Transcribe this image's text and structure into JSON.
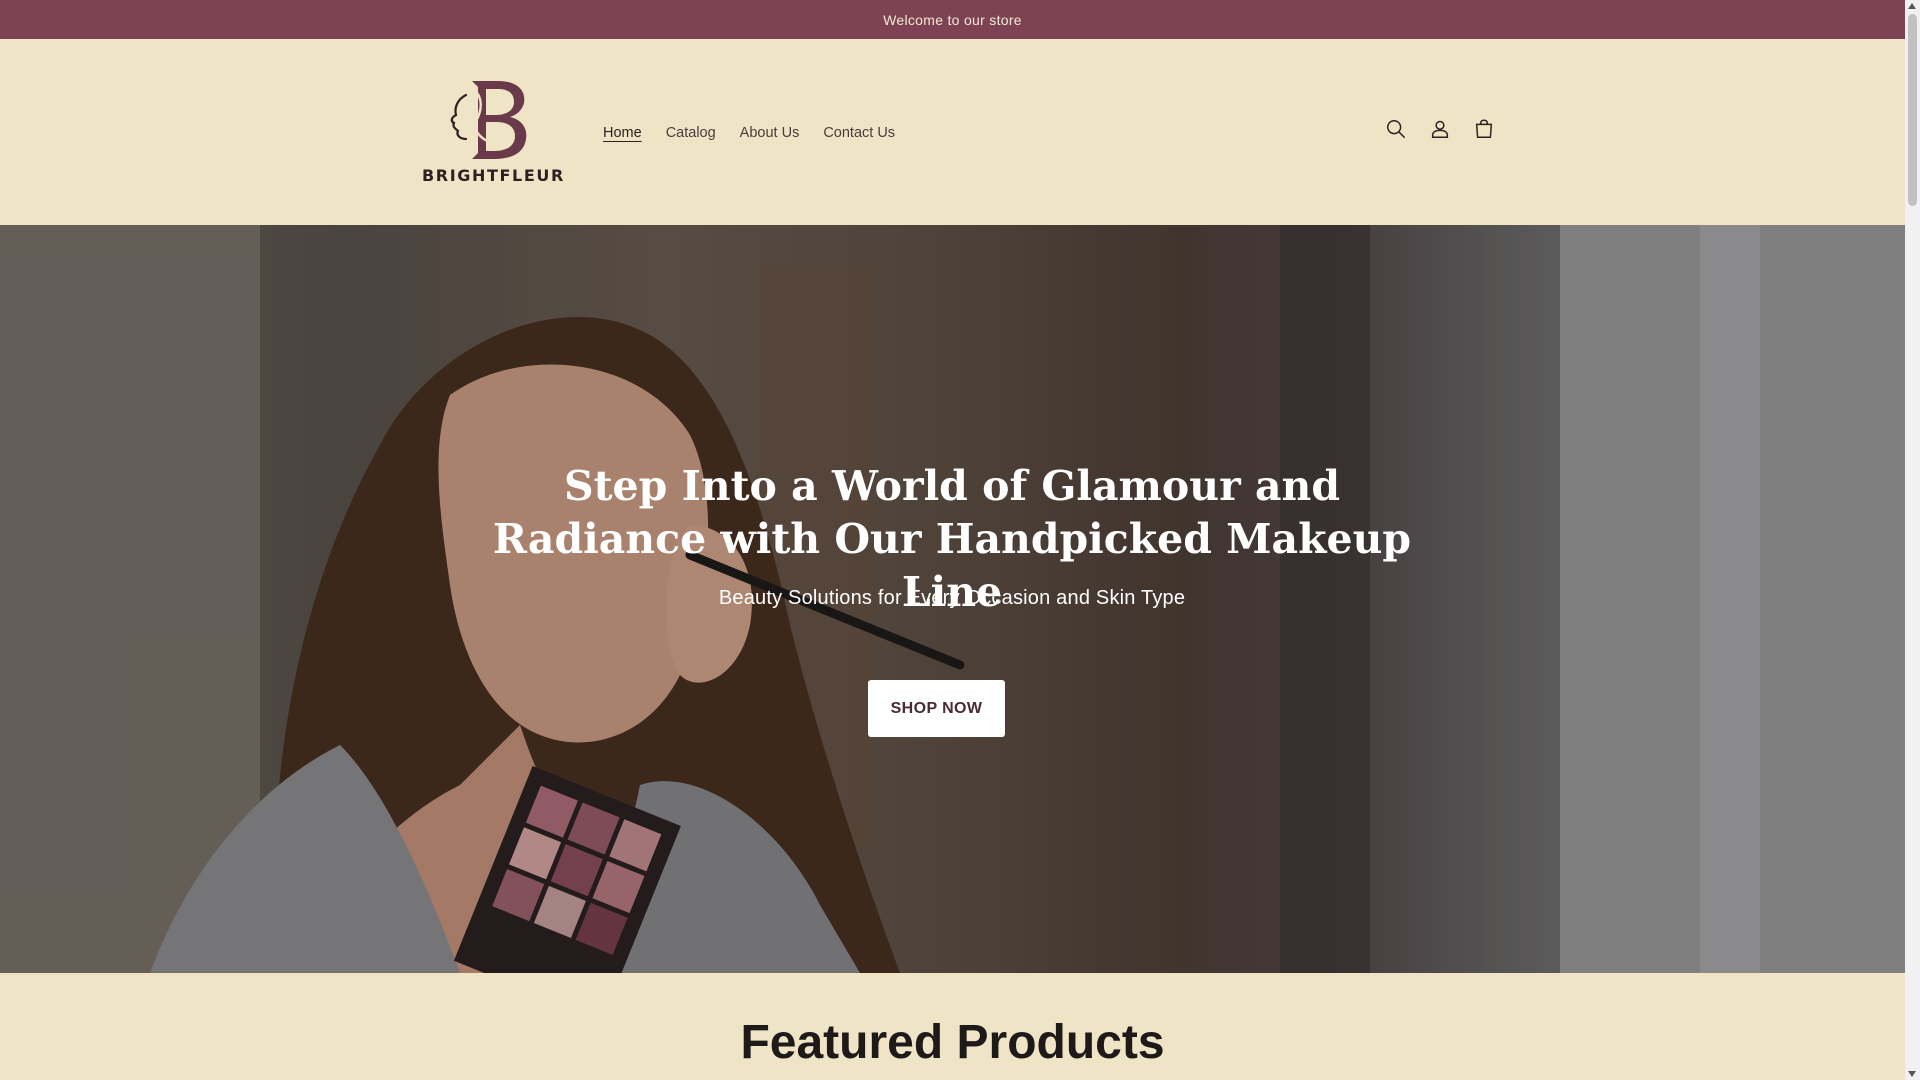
{
  "announcement": {
    "text": "Welcome to our store"
  },
  "brand": {
    "name": "BRIGHTFLEUR",
    "logo_color": "#6b3a4a"
  },
  "nav": {
    "items": [
      {
        "label": "Home",
        "active": true
      },
      {
        "label": "Catalog",
        "active": false
      },
      {
        "label": "About Us",
        "active": false
      },
      {
        "label": "Contact Us",
        "active": false
      }
    ]
  },
  "header_icons": [
    "search-icon",
    "account-icon",
    "cart-icon"
  ],
  "hero": {
    "title": "Step Into a World of Glamour and Radiance with Our Handpicked Makeup Line",
    "subtitle": "Beauty Solutions for Every Occasion and Skin Type",
    "button_label": "SHOP NOW"
  },
  "featured": {
    "title": "Featured Products"
  },
  "colors": {
    "announcement_bg": "#7d4355",
    "page_bg": "#efe4c6",
    "accent": "#7d4355"
  }
}
